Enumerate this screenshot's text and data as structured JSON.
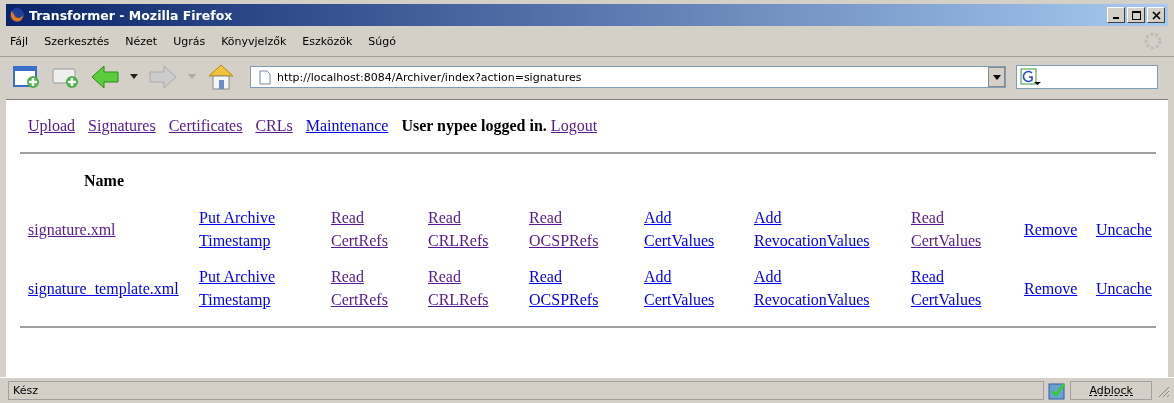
{
  "window": {
    "title": "Transformer - Mozilla Firefox"
  },
  "menu": [
    "Fájl",
    "Szerkesztés",
    "Nézet",
    "Ugrás",
    "Könyvjelzők",
    "Eszközök",
    "Súgó"
  ],
  "address": {
    "value": "http://localhost:8084/Archiver/index?action=signatures"
  },
  "nav": [
    {
      "label": "Upload",
      "visited": true
    },
    {
      "label": "Signatures",
      "visited": true
    },
    {
      "label": "Certificates",
      "visited": true
    },
    {
      "label": "CRLs",
      "visited": true
    },
    {
      "label": "Maintenance",
      "visited": false
    }
  ],
  "user_status": "User nypee logged in.",
  "logout": {
    "label": "Logout",
    "visited": true
  },
  "table": {
    "columns": [
      "Name"
    ],
    "rows": [
      {
        "cells": [
          {
            "label": "signature.xml",
            "visited": true
          },
          {
            "label": "Put Archive\nTimestamp",
            "visited": false
          },
          {
            "label": "Read\nCertRefs",
            "visited": true
          },
          {
            "label": "Read\nCRLRefs",
            "visited": true
          },
          {
            "label": "Read\nOCSPRefs",
            "visited": true
          },
          {
            "label": "Add\nCertValues",
            "visited": false
          },
          {
            "label": "Add\nRevocationValues",
            "visited": false
          },
          {
            "label": "Read\nCertValues",
            "visited": true
          },
          {
            "label": "Remove",
            "visited": false
          },
          {
            "label": "Uncache",
            "visited": false
          }
        ]
      },
      {
        "cells": [
          {
            "label": "signature_template.xml",
            "visited": false
          },
          {
            "label": "Put Archive\nTimestamp",
            "visited": false
          },
          {
            "label": "Read\nCertRefs",
            "visited": true
          },
          {
            "label": "Read\nCRLRefs",
            "visited": true
          },
          {
            "label": "Read\nOCSPRefs",
            "visited": false
          },
          {
            "label": "Add\nCertValues",
            "visited": false
          },
          {
            "label": "Add\nRevocationValues",
            "visited": false
          },
          {
            "label": "Read\nCertValues",
            "visited": false
          },
          {
            "label": "Remove",
            "visited": false
          },
          {
            "label": "Uncache",
            "visited": false
          }
        ]
      }
    ]
  },
  "status_bar": {
    "text": "Kész",
    "adblock": "Adblock"
  }
}
